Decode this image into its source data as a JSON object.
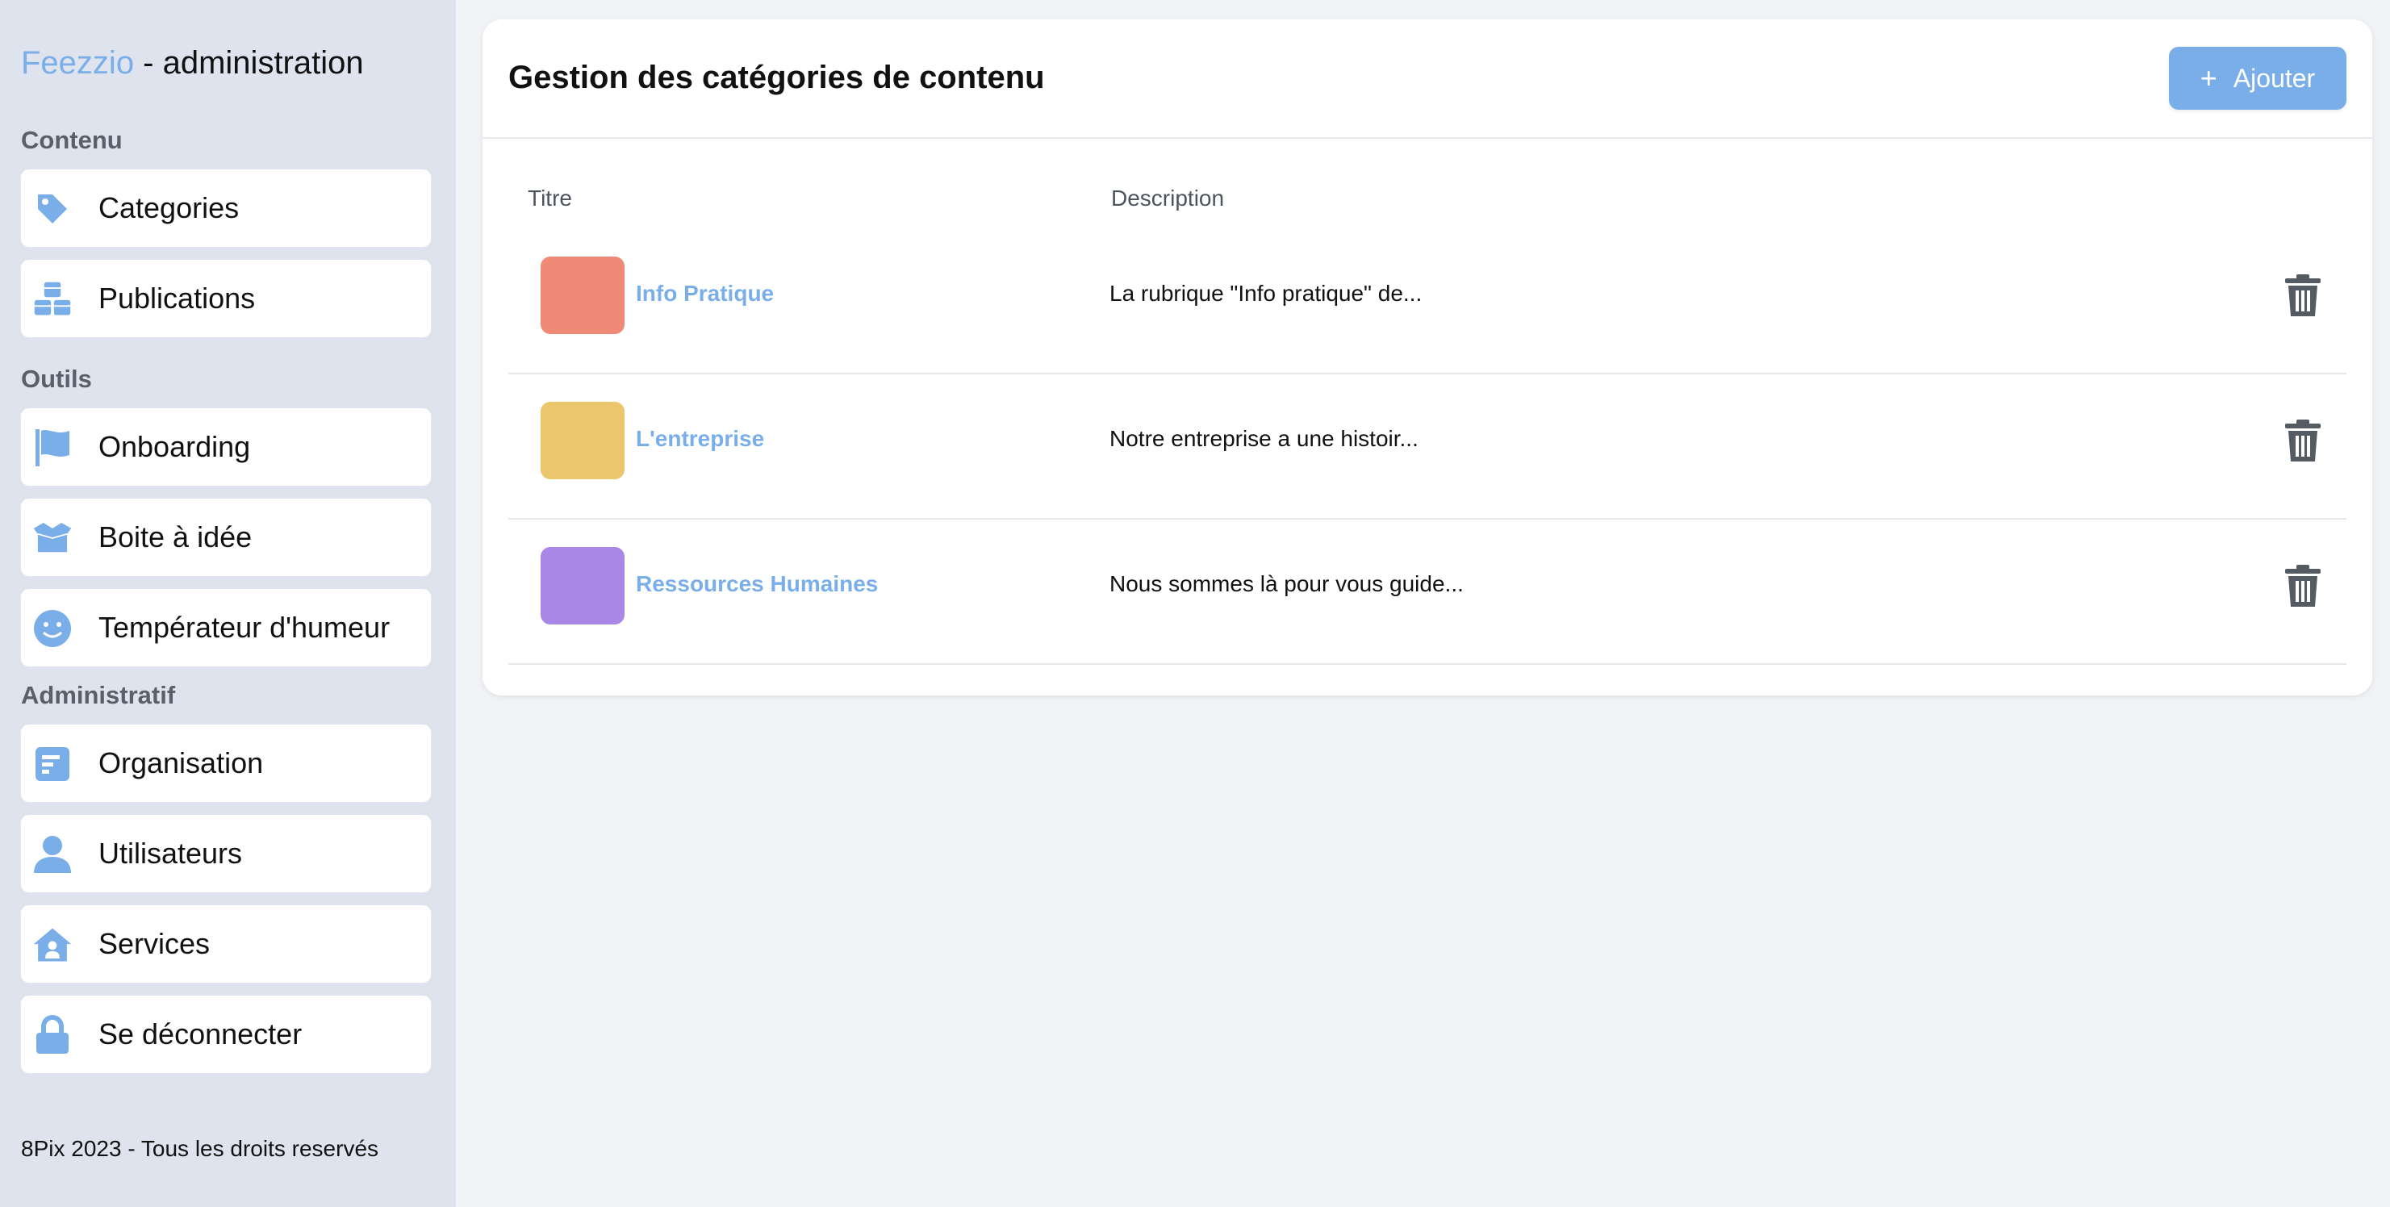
{
  "brand": {
    "name": "Feezzio",
    "suffix": " - administration"
  },
  "sidebar": {
    "sections": [
      {
        "title": "Contenu",
        "items": [
          {
            "label": "Categories",
            "icon": "tag-icon"
          },
          {
            "label": "Publications",
            "icon": "cubes-icon"
          }
        ]
      },
      {
        "title": "Outils",
        "items": [
          {
            "label": "Onboarding",
            "icon": "flag-icon"
          },
          {
            "label": "Boite à idée",
            "icon": "box-open-icon"
          },
          {
            "label": "Températeur d'humeur",
            "icon": "smile-icon"
          }
        ]
      },
      {
        "title": "Administratif",
        "items": [
          {
            "label": "Organisation",
            "icon": "building-list-icon"
          },
          {
            "label": "Utilisateurs",
            "icon": "user-icon"
          },
          {
            "label": "Services",
            "icon": "house-user-icon"
          },
          {
            "label": "Se déconnecter",
            "icon": "lock-icon"
          }
        ]
      }
    ],
    "footer": "8Pix 2023 - Tous les droits reservés"
  },
  "main": {
    "title": "Gestion des catégories de contenu",
    "add_button": {
      "label": "Ajouter",
      "icon": "plus-icon"
    },
    "table": {
      "columns": [
        "Titre",
        "Description"
      ],
      "rows": [
        {
          "title": "Info Pratique",
          "description": "La rubrique \"Info pratique\" de...",
          "color": "#ef8a76"
        },
        {
          "title": "L'entreprise",
          "description": "Notre entreprise a une histoir...",
          "color": "#ecc66c"
        },
        {
          "title": "Ressources Humaines",
          "description": "Nous sommes là pour vous guide...",
          "color": "#a987e6"
        }
      ]
    }
  },
  "colors": {
    "accent": "#7aaee8",
    "sidebar_bg": "#dfe3ee",
    "page_bg": "#f1f3f7",
    "trash": "#555b63"
  }
}
